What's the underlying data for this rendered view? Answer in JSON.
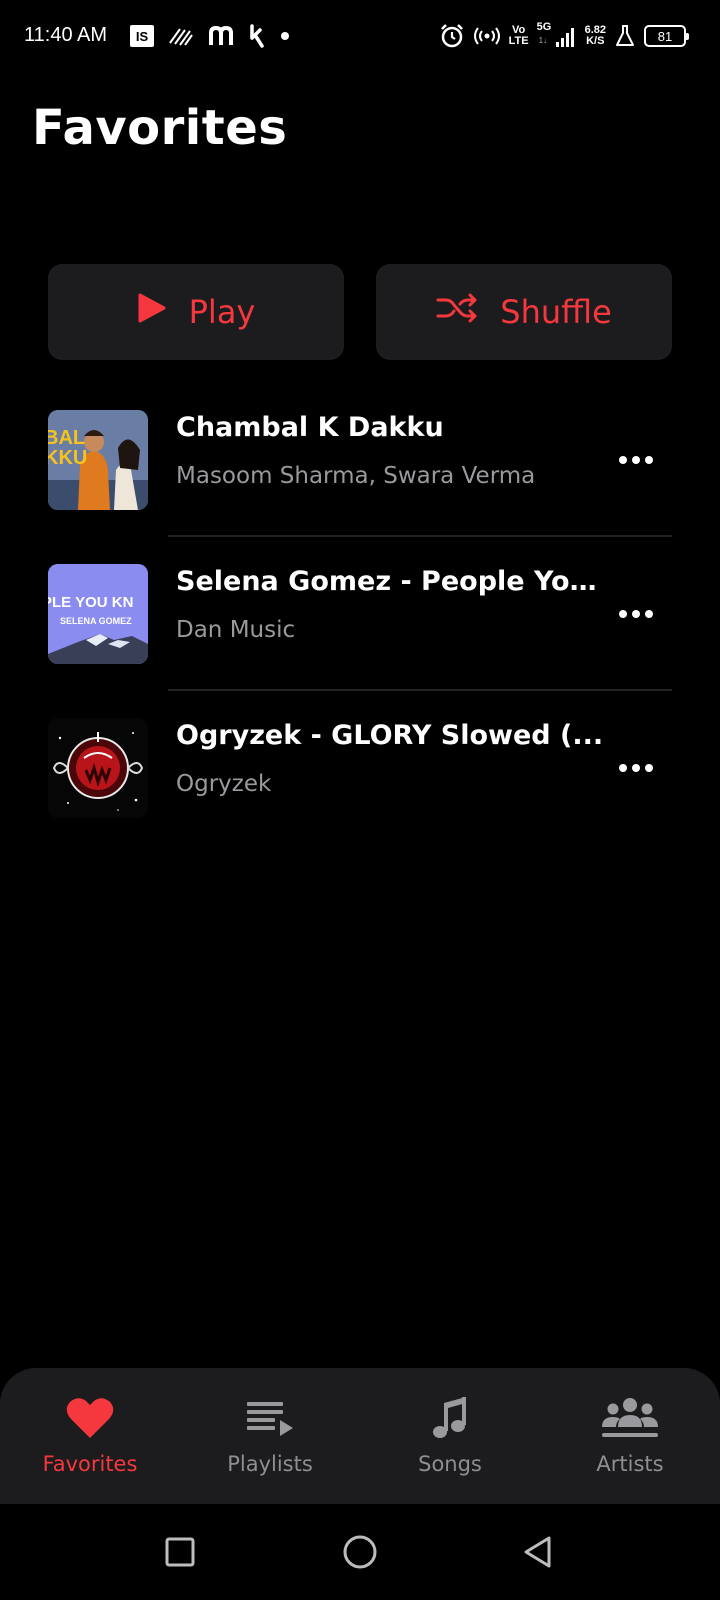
{
  "status_bar": {
    "time": "11:40 AM",
    "left_icons": [
      "is-app-icon",
      "wave-app-icon",
      "m-app-icon",
      "k-app-icon",
      "dot-icon"
    ],
    "is_label": "IS",
    "volte_top": "Vo",
    "volte_bottom": "LTE",
    "network": "5G",
    "network_sub": "1↓",
    "speed_value": "6.82",
    "speed_unit": "K/S",
    "battery": "81"
  },
  "page": {
    "title": "Favorites"
  },
  "actions": {
    "play_label": "Play",
    "shuffle_label": "Shuffle"
  },
  "songs": [
    {
      "title": "Chambal K Dakku",
      "artist": "Masoom Sharma, Swara Verma",
      "art_text": "BAL KKU"
    },
    {
      "title": "Selena Gomez - People You...",
      "artist": "Dan Music",
      "art_text_1": "PLE YOU KN",
      "art_text_2": "SELENA GOMEZ"
    },
    {
      "title": "Ogryzek - GLORY Slowed (...",
      "artist": "Ogryzek"
    }
  ],
  "bottom_nav": {
    "items": [
      {
        "label": "Favorites",
        "icon": "heart-icon",
        "active": true
      },
      {
        "label": "Playlists",
        "icon": "playlist-icon",
        "active": false
      },
      {
        "label": "Songs",
        "icon": "music-note-icon",
        "active": false
      },
      {
        "label": "Artists",
        "icon": "artists-icon",
        "active": false
      }
    ]
  },
  "colors": {
    "accent": "#f5383e",
    "background": "#000000",
    "surface": "#1c1c1e",
    "secondary_text": "#9a9a9e"
  },
  "system_nav": [
    "recents-button",
    "home-button",
    "back-button"
  ]
}
